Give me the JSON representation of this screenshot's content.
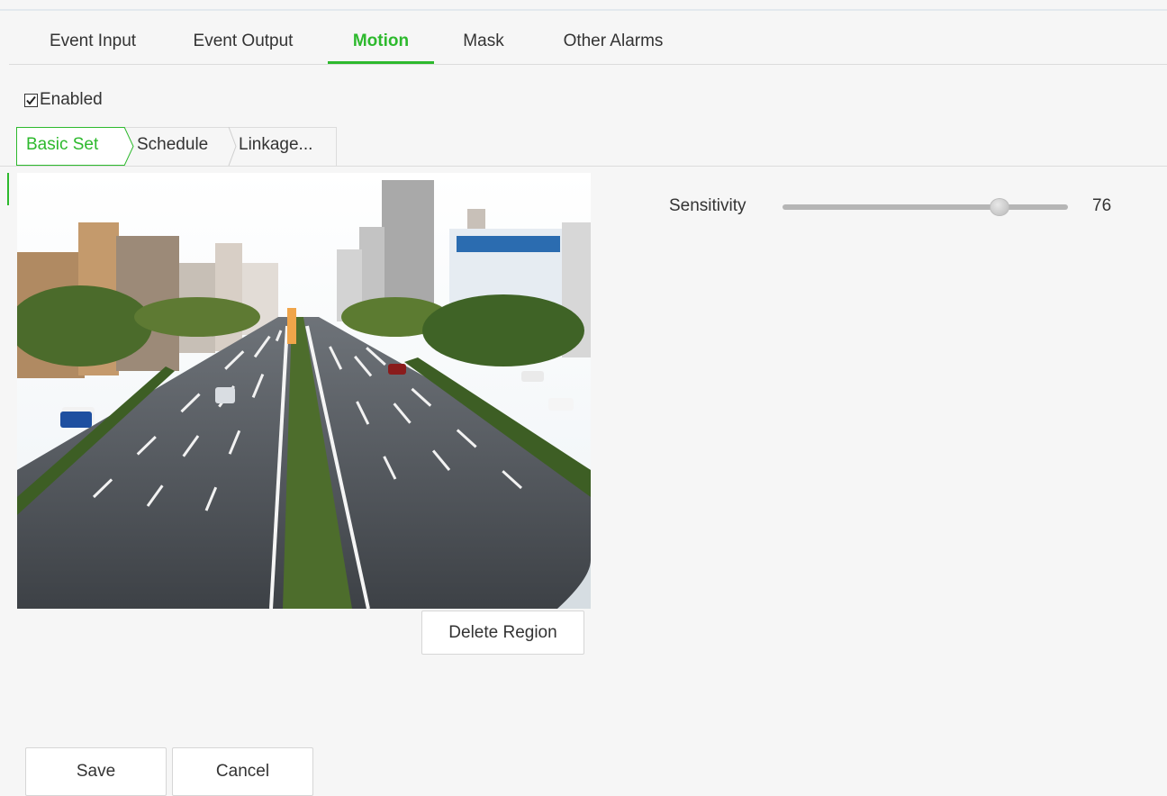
{
  "tabs": [
    {
      "label": "Event Input",
      "active": false
    },
    {
      "label": "Event Output",
      "active": false
    },
    {
      "label": "Motion",
      "active": true
    },
    {
      "label": "Mask",
      "active": false
    },
    {
      "label": "Other Alarms",
      "active": false
    }
  ],
  "enabled": {
    "label": "Enabled",
    "checked": true
  },
  "subtabs": [
    {
      "label": "Basic Set",
      "active": true
    },
    {
      "label": "Schedule",
      "active": false
    },
    {
      "label": "Linkage...",
      "active": false
    }
  ],
  "sensitivity": {
    "label": "Sensitivity",
    "value": "76",
    "min": 0,
    "max": 100
  },
  "buttons": {
    "delete_region": "Delete Region",
    "save": "Save",
    "cancel": "Cancel"
  },
  "colors": {
    "accent": "#2db92d"
  }
}
